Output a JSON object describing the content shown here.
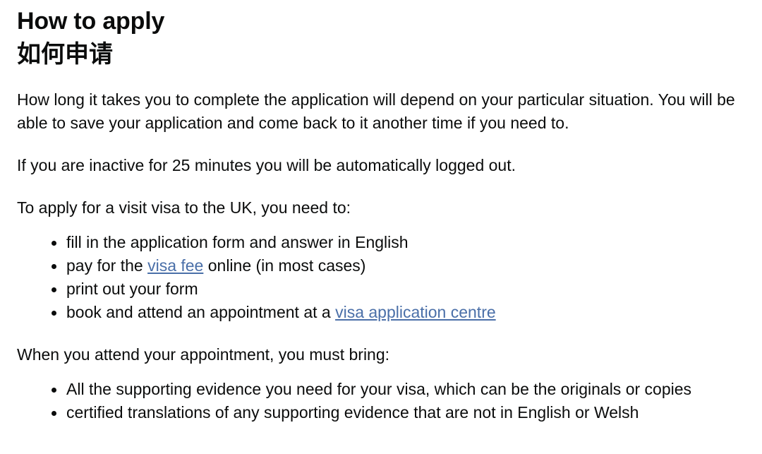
{
  "heading": {
    "english": "How to apply",
    "chinese": "如何申请"
  },
  "paragraphs": {
    "intro": "How long it takes you to complete the application will depend on your particular situation. You will be able to save your application and come back to it another time if you need to.",
    "timeout": "If you are inactive for 25 minutes you will be automatically logged out.",
    "apply_lead_in": "To apply for a visit visa to the UK, you need to:",
    "appointment_lead_in": "When you attend your appointment, you must bring:"
  },
  "apply_steps": {
    "item_1": "fill in the application form and answer in English",
    "item_2_before": "pay for the ",
    "item_2_link": "visa fee",
    "item_2_after": " online (in most cases)",
    "item_3": "print out your form",
    "item_4_before": "book and attend an appointment at a ",
    "item_4_link": "visa application centre"
  },
  "appointment_items": {
    "item_1": "All the supporting evidence you need for your visa, which can be the originals or copies",
    "item_2": "certified translations of any supporting evidence that are not in English or Welsh"
  },
  "colors": {
    "text": "#0b0c0c",
    "link": "#4a6fa8",
    "background": "#ffffff"
  }
}
